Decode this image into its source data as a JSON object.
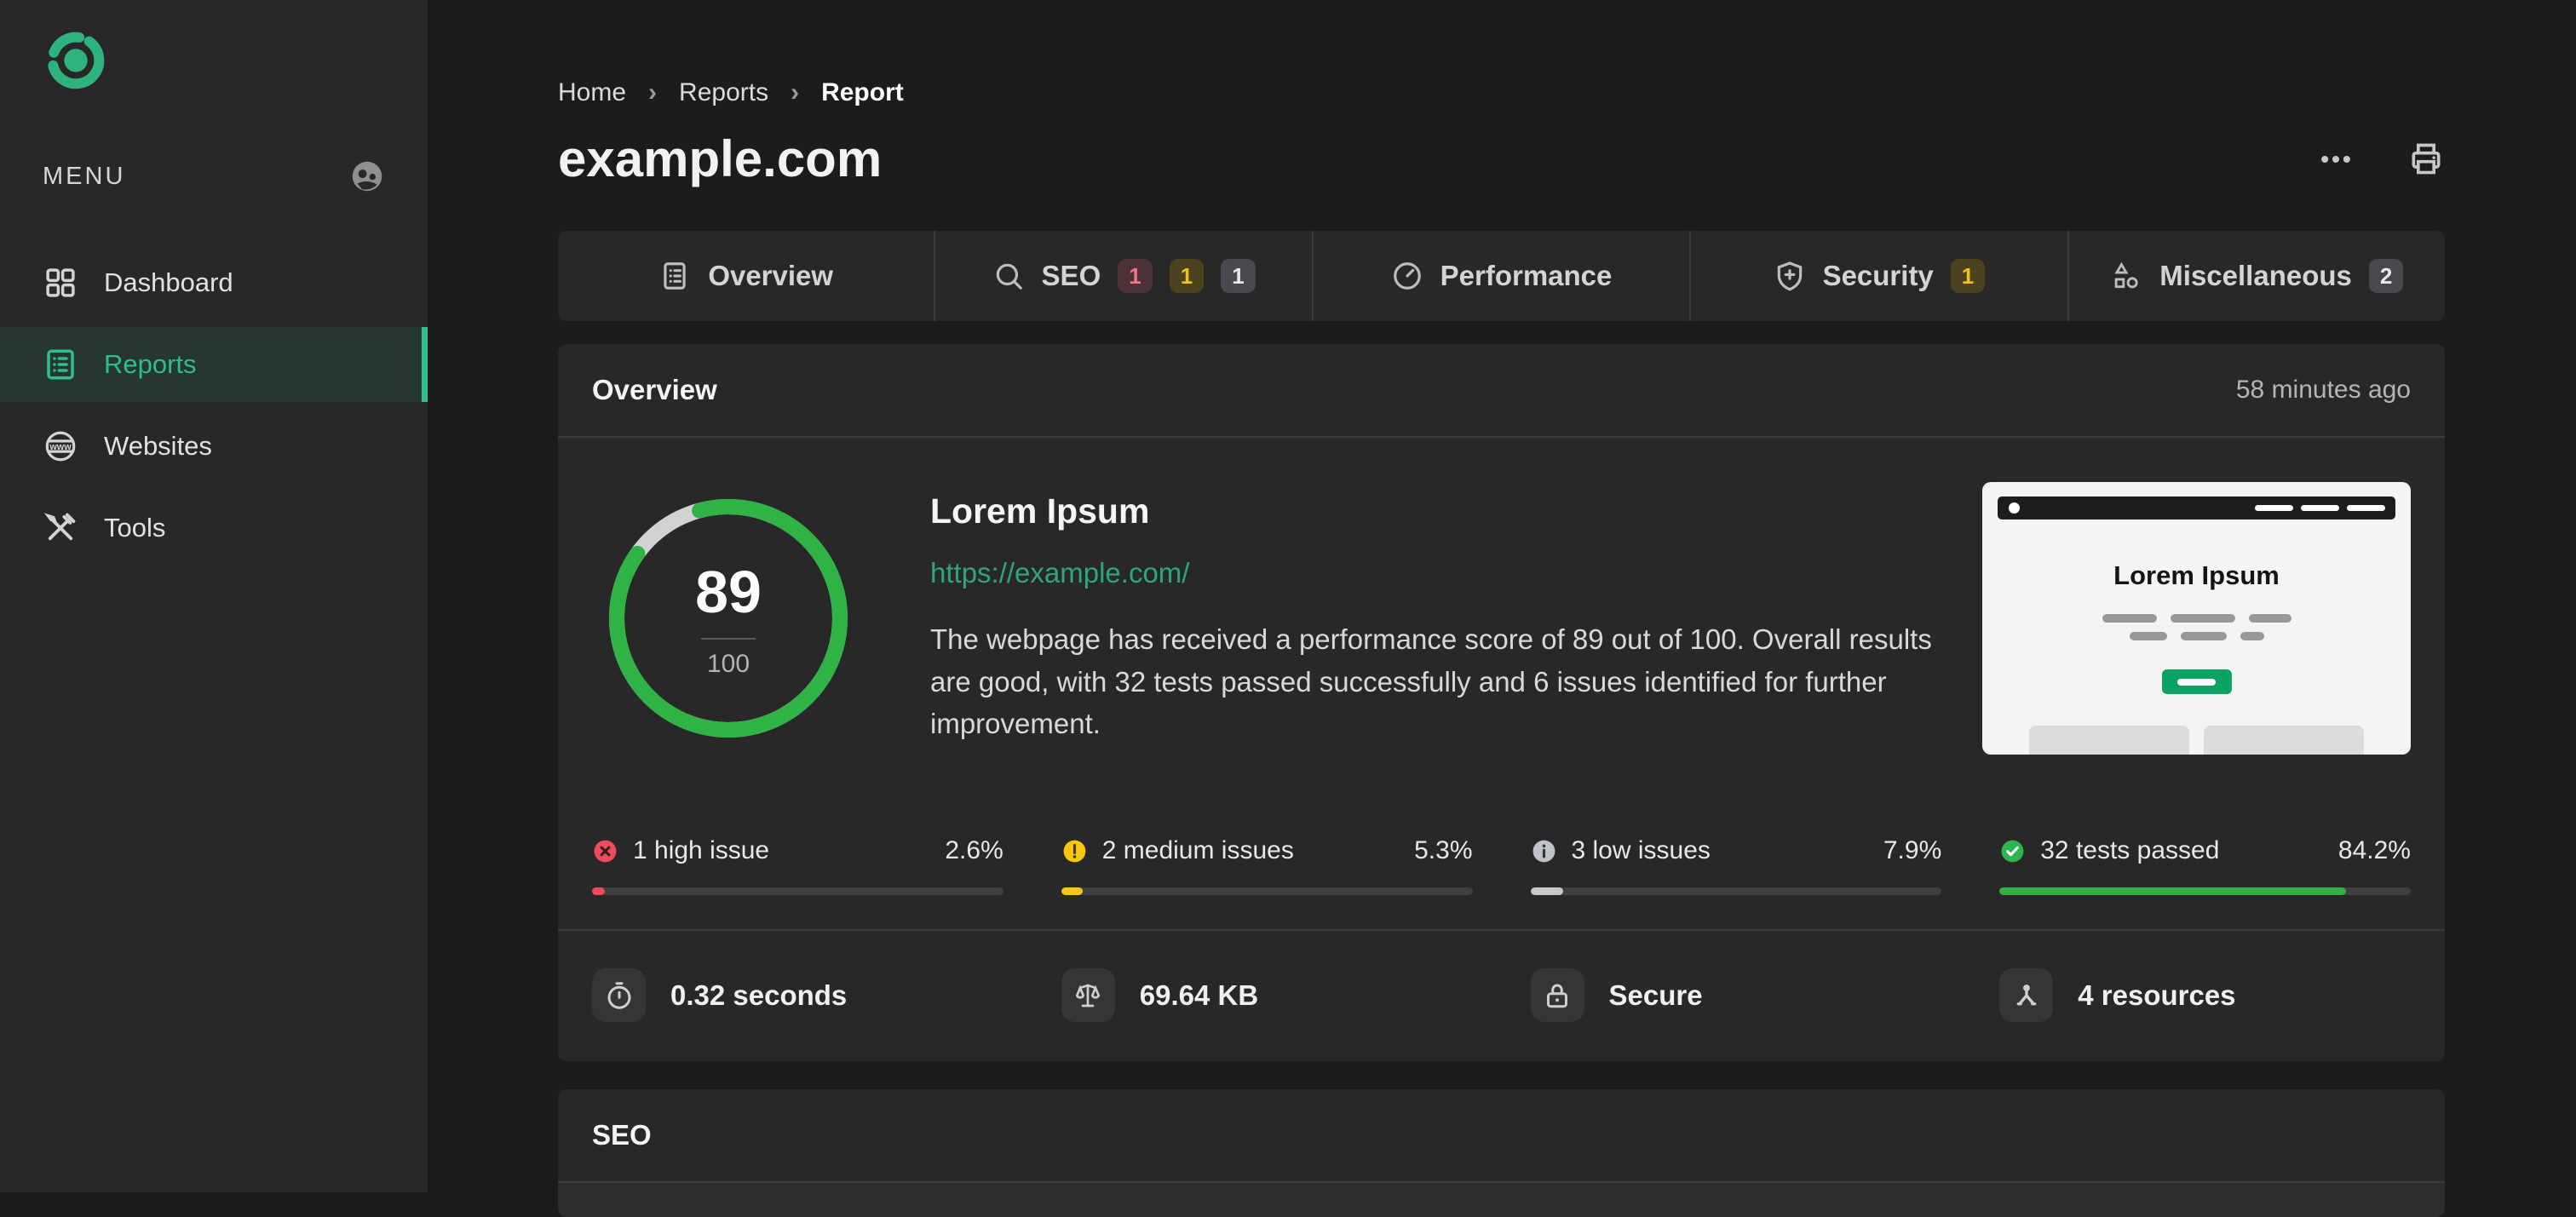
{
  "colors": {
    "accent_green": "#2fbd8b",
    "score_green": "#2fb344",
    "high_red": "#ef4b5e",
    "medium_yellow": "#f6c710",
    "low_gray": "#c9c9c9",
    "page_bg": "#1c1c1c",
    "panel_bg": "#282828"
  },
  "sidebar": {
    "menu_label": "MENU",
    "items": [
      {
        "label": "Dashboard",
        "active": false
      },
      {
        "label": "Reports",
        "active": true
      },
      {
        "label": "Websites",
        "active": false
      },
      {
        "label": "Tools",
        "active": false
      }
    ]
  },
  "header": {
    "breadcrumb": {
      "home": "Home",
      "reports": "Reports",
      "current": "Report"
    },
    "title": "example.com"
  },
  "tabs": [
    {
      "label": "Overview"
    },
    {
      "label": "SEO",
      "badges": [
        {
          "text": "1"
        },
        {
          "text": "1"
        },
        {
          "text": "1"
        }
      ]
    },
    {
      "label": "Performance"
    },
    {
      "label": "Security",
      "badges": [
        {
          "text": "1"
        }
      ]
    },
    {
      "label": "Miscellaneous",
      "badges": [
        {
          "text": "2"
        }
      ]
    }
  ],
  "overview": {
    "section_title": "Overview",
    "timestamp": "58 minutes ago",
    "score": {
      "value": "89",
      "max": "100"
    },
    "site": {
      "name": "Lorem Ipsum",
      "url": "https://example.com/",
      "description": "The webpage has received a performance score of 89 out of 100. Overall results are good, with 32 tests passed successfully and 6 issues identified for further improvement."
    },
    "thumbnail": {
      "heading": "Lorem Ipsum"
    },
    "stats": [
      {
        "label": "1 high issue",
        "pct_text": "2.6%",
        "pct_value": 2.6,
        "type": "high"
      },
      {
        "label": "2 medium issues",
        "pct_text": "5.3%",
        "pct_value": 5.3,
        "type": "medium"
      },
      {
        "label": "3 low issues",
        "pct_text": "7.9%",
        "pct_value": 7.9,
        "type": "low"
      },
      {
        "label": "32 tests passed",
        "pct_text": "84.2%",
        "pct_value": 84.2,
        "type": "passed"
      }
    ],
    "metrics": [
      {
        "label": "0.32 seconds",
        "icon": "stopwatch-icon"
      },
      {
        "label": "69.64 KB",
        "icon": "scales-icon"
      },
      {
        "label": "Secure",
        "icon": "lock-icon"
      },
      {
        "label": "4 resources",
        "icon": "resources-icon"
      }
    ]
  },
  "seo_section": {
    "title": "SEO"
  }
}
